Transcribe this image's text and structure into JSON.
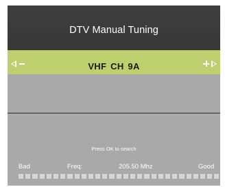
{
  "dialog": {
    "title": "DTV Manual Tuning"
  },
  "channel": {
    "band": "VHF",
    "label": "CH",
    "number": "9A",
    "display": "VHF  CH  9A"
  },
  "search": {
    "prompt": "Press OK to search"
  },
  "signal": {
    "bad_label": "Bad",
    "freq_label": "Freq:",
    "freq_value": "205.50 Mhz",
    "good_label": "Good",
    "segment_count": 29,
    "level": 0
  },
  "colors": {
    "title_bg": "#3c3c3c",
    "channel_bar_bg": "#bdd06d",
    "body_bg": "#a9a9a9",
    "text_light": "#ffffff",
    "segment": "#d6d6d6"
  },
  "icons": {
    "left_arrow": "triangle-left-outline-icon",
    "minus": "minus-icon",
    "plus": "plus-icon",
    "right_arrow": "triangle-right-outline-icon"
  }
}
